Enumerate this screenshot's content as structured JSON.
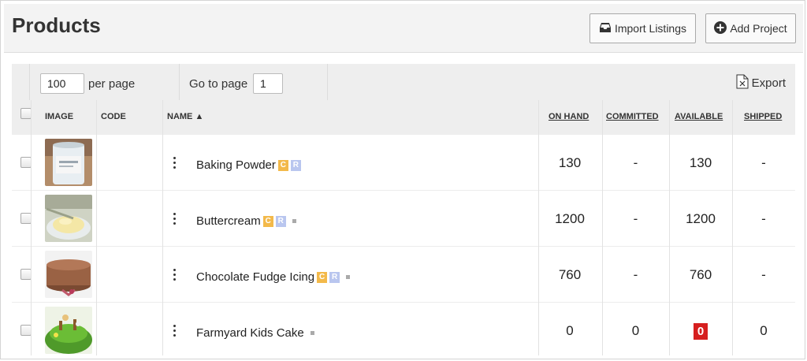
{
  "header": {
    "title": "Products",
    "import_label": "Import Listings",
    "add_label": "Add Project"
  },
  "toolbar": {
    "per_page_value": "100",
    "per_page_label": "per page",
    "goto_label": "Go to page",
    "goto_value": "1",
    "export_label": "Export"
  },
  "columns": {
    "image": "IMAGE",
    "code": "CODE",
    "name": "NAME ▲",
    "on_hand": "ON HAND",
    "committed": "COMMITTED",
    "available": "AVAILABLE",
    "shipped": "SHIPPED"
  },
  "rows": [
    {
      "code": "",
      "name": "Baking Powder",
      "badge_c": "C",
      "badge_r": "R",
      "on_hand": "130",
      "committed": "-",
      "available": "130",
      "shipped": "-"
    },
    {
      "code": "",
      "name": "Buttercream",
      "badge_c": "C",
      "badge_r": "R",
      "on_hand": "1200",
      "committed": "-",
      "available": "1200",
      "shipped": "-"
    },
    {
      "code": "",
      "name": "Chocolate Fudge Icing",
      "badge_c": "C",
      "badge_r": "R",
      "on_hand": "760",
      "committed": "-",
      "available": "760",
      "shipped": "-"
    },
    {
      "code": "",
      "name": "Farmyard Kids Cake",
      "on_hand": "0",
      "committed": "0",
      "available": "0",
      "shipped": "0"
    }
  ],
  "colors": {
    "badge_c": "#f3b94a",
    "badge_r": "#b9c6ef",
    "alert": "#d61f1f"
  },
  "icons": {
    "import": "inbox-tray-icon",
    "add": "plus-circle-icon",
    "export": "spreadsheet-file-icon",
    "row_menu": "kebab-menu-icon"
  }
}
